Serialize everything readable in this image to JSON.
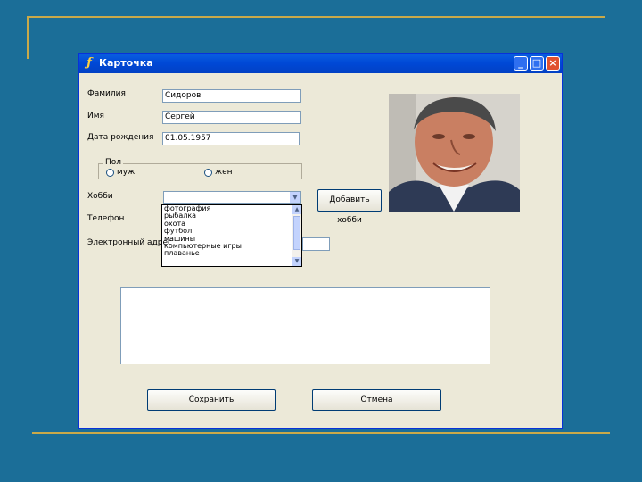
{
  "window": {
    "title": "Карточка"
  },
  "form": {
    "surname_label": "Фамилия",
    "surname_value": "Сидоров",
    "name_label": "Имя",
    "name_value": "Сергей",
    "birthdate_label": "Дата рождения",
    "birthdate_value": "01.05.1957",
    "gender": {
      "label": "Пол",
      "male": "муж",
      "female": "жен"
    },
    "hobby_label": "Хобби",
    "hobby_value": "",
    "phone_label": "Телефон",
    "email_label": "Электронный адрес",
    "add_hobby_button": "Добавить хобби",
    "hobby_options": [
      "фотография",
      "рыбалка",
      "охота",
      "футбол",
      "машины",
      "компьютерные игры",
      "плаванье"
    ]
  },
  "buttons": {
    "save": "Сохранить",
    "cancel": "Отмена"
  },
  "colors": {
    "desktop": "#1b6e98",
    "accent": "#c9a94a",
    "titlebar": "#0048d6"
  }
}
